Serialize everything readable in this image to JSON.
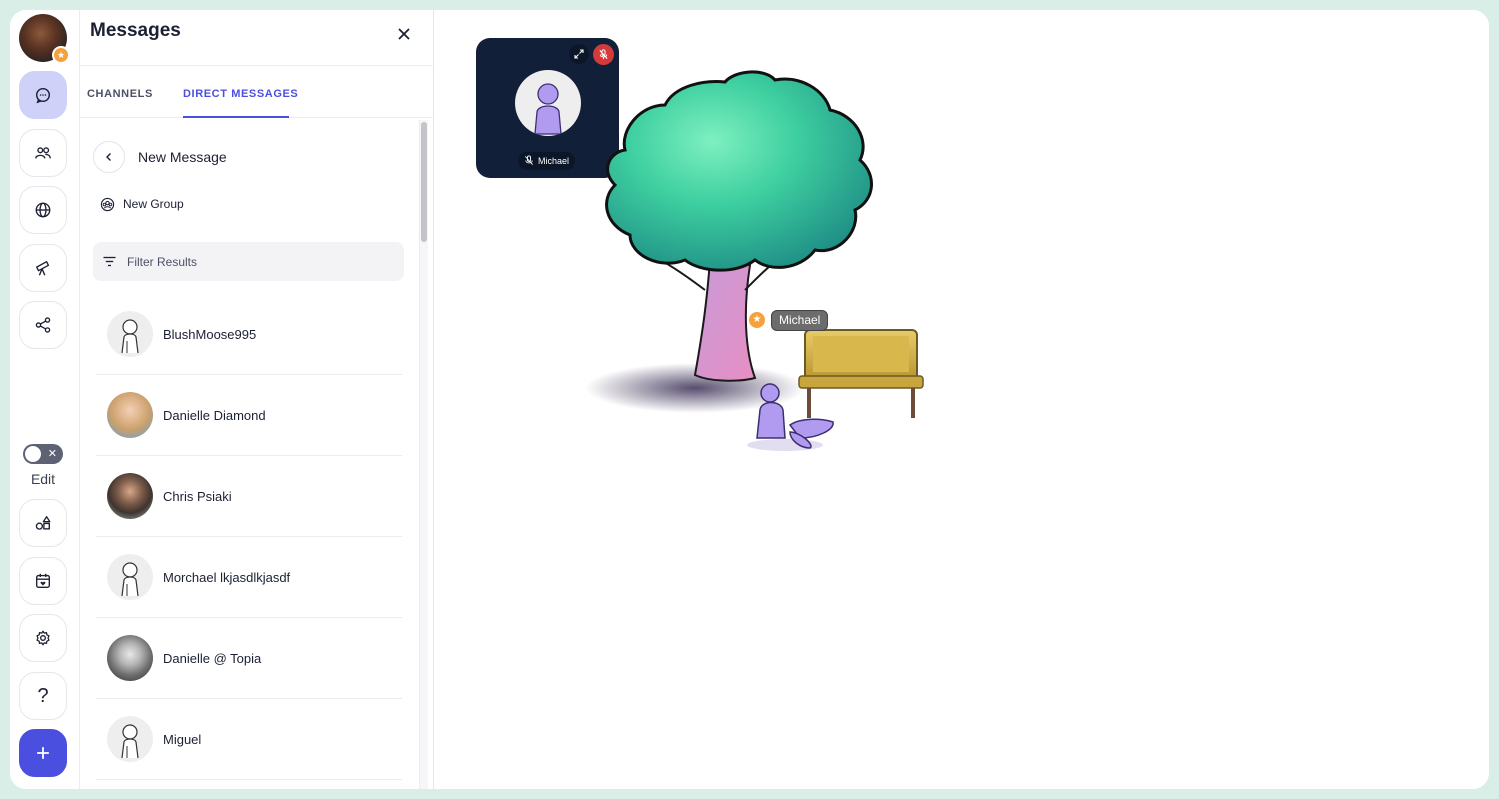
{
  "rail": {
    "edit_label": "Edit",
    "help_label": "?"
  },
  "panel": {
    "title": "Messages",
    "tabs": [
      {
        "label": "CHANNELS",
        "active": false
      },
      {
        "label": "DIRECT MESSAGES",
        "active": true
      }
    ],
    "new_message_title": "New Message",
    "new_group_label": "New Group",
    "filter_placeholder": "Filter Results",
    "contacts": [
      {
        "name": "BlushMoose995",
        "avatar": "default-avatar"
      },
      {
        "name": "Danielle Diamond",
        "avatar": "photo"
      },
      {
        "name": "Chris Psiaki",
        "avatar": "photo"
      },
      {
        "name": "Morchael lkjasdlkjasdf",
        "avatar": "default-avatar"
      },
      {
        "name": "Danielle @ Topia",
        "avatar": "photo"
      },
      {
        "name": "Miguel",
        "avatar": "default-avatar"
      }
    ]
  },
  "video_tile": {
    "name": "Michael",
    "muted": true
  },
  "world": {
    "player_name": "Michael"
  },
  "colors": {
    "accent": "#4b4fe0",
    "accent_soft": "#cfd1f8",
    "mute_red": "#d53a3a",
    "tile_bg": "#112038",
    "frame_bg": "#d9eee6"
  }
}
